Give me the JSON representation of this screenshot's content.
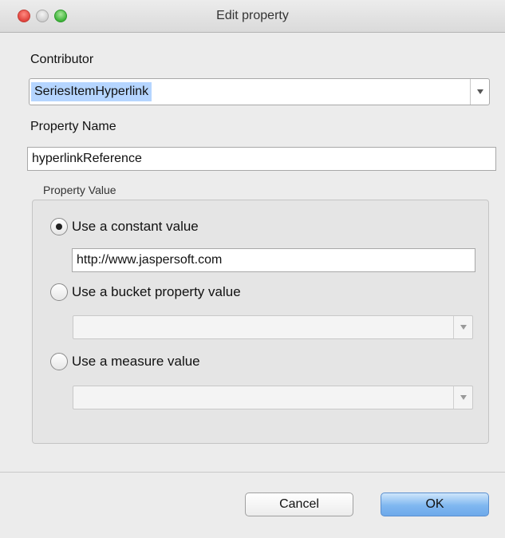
{
  "window": {
    "title": "Edit property"
  },
  "contributor": {
    "label": "Contributor",
    "value": "SeriesItemHyperlink"
  },
  "property_name": {
    "label": "Property Name",
    "value": "hyperlinkReference"
  },
  "property_value": {
    "group_label": "Property Value",
    "options": [
      {
        "label": "Use a constant value",
        "selected": true,
        "value": "http://www.jaspersoft.com"
      },
      {
        "label": "Use a bucket property value",
        "selected": false,
        "value": ""
      },
      {
        "label": "Use a measure value",
        "selected": false,
        "value": ""
      }
    ]
  },
  "buttons": {
    "cancel": "Cancel",
    "ok": "OK"
  },
  "colors": {
    "selection": "#b5d5ff",
    "ok_button": "#7fb7f0",
    "close": "#e0443e",
    "maximize": "#3fb33b"
  }
}
